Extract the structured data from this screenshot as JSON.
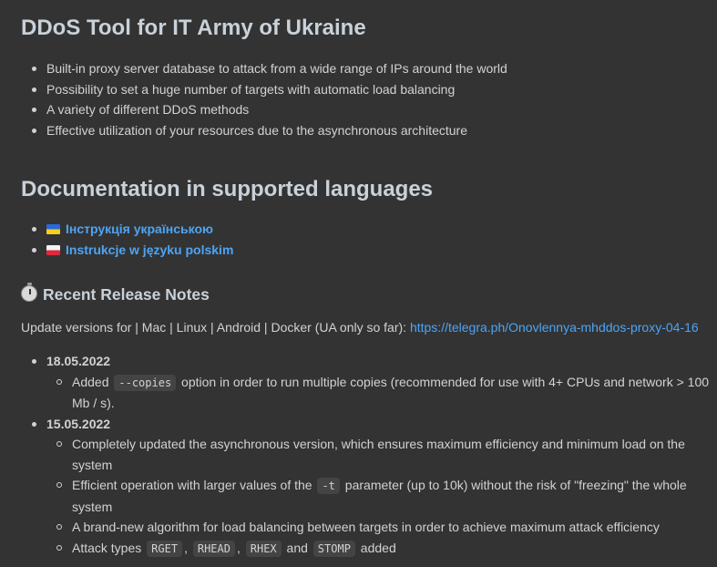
{
  "main_title": "DDoS Tool for IT Army of Ukraine",
  "features": [
    "Built-in proxy server database to attack from a wide range of IPs around the world",
    "Possibility to set a huge number of targets with automatic load balancing",
    "A variety of different DDoS methods",
    "Effective utilization of your resources due to the asynchronous architecture"
  ],
  "docs": {
    "title": "Documentation in supported languages",
    "links": [
      {
        "flag": "ukraine-flag-icon",
        "label": "Інструкція українською"
      },
      {
        "flag": "poland-flag-icon",
        "label": "Instrukcje w języku polskim"
      }
    ]
  },
  "release_notes": {
    "icon": "stopwatch-icon",
    "title": "Recent Release Notes",
    "update_prefix": "Update versions for | Mac | Linux | Android | Docker (UA only so far): ",
    "update_link": "https://telegra.ph/Onovlennya-mhddos-proxy-04-16",
    "releases": [
      {
        "date": "18.05.2022",
        "changes": [
          {
            "before": "Added ",
            "code": "--copies",
            "after": " option in order to run multiple copies (recommended for use with 4+ CPUs and network > 100 Mb / s)."
          }
        ]
      },
      {
        "date": "15.05.2022",
        "changes": [
          {
            "text": "Completely updated the asynchronous version, which ensures maximum efficiency and minimum load on the system"
          },
          {
            "before": "Efficient operation with larger values of the ",
            "code": "-t",
            "after": " parameter (up to 10k) without the risk of \"freezing\" the whole system"
          },
          {
            "text": "A brand-new algorithm for load balancing between targets in order to achieve maximum attack efficiency"
          },
          {
            "prefix": "Attack types ",
            "codes": [
              "RGET",
              "RHEAD",
              "RHEX",
              "STOMP"
            ],
            "sep1": ", ",
            "sep2": ", ",
            "sep3": " and ",
            "suffix": " added"
          }
        ]
      }
    ]
  }
}
